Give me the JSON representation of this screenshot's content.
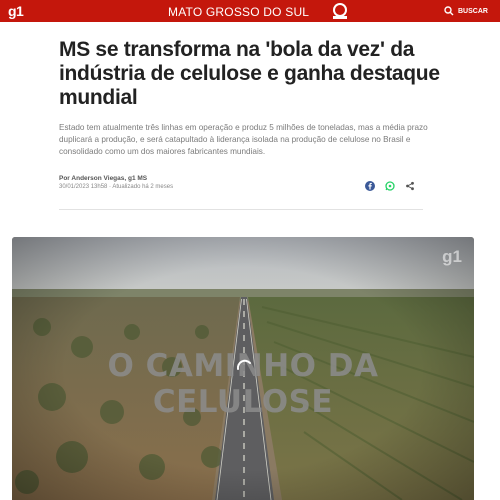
{
  "header": {
    "logo": "g1",
    "section": "MATO GROSSO DO SUL",
    "search_label": "BUSCAR",
    "tv_logo_icon": "tv-morena-logo",
    "bg_color": "#c4170c"
  },
  "article": {
    "headline": "MS se transforma na 'bola da vez' da indústria de celulose e ganha destaque mundial",
    "summary": "Estado tem atualmente três linhas em operação e produz 5 milhões de toneladas, mas a média prazo duplicará a produção, e será catapultado à liderança isolada na produção de celulose no Brasil e consolidado como um dos maiores fabricantes mundiais.",
    "byline": "Por Anderson Viegas, g1 MS",
    "dateline": "30/01/2023 13h58 · Atualizado há 2 meses",
    "share_icons": [
      "facebook-icon",
      "whatsapp-icon",
      "share-icon"
    ]
  },
  "video": {
    "overlay_title": "O CAMINHO DA CELULOSE",
    "watermark": "g1"
  }
}
